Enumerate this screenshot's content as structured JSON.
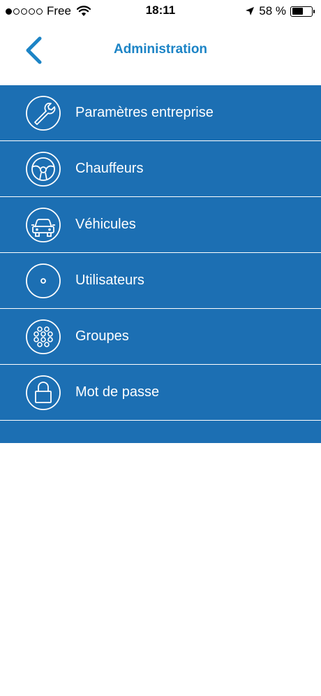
{
  "status_bar": {
    "carrier": "Free",
    "time": "18:11",
    "battery_percent_text": "58 %",
    "battery_level": 0.58
  },
  "nav": {
    "title": "Administration",
    "back_icon": "chevron-left-icon"
  },
  "colors": {
    "accent": "#1c84c6",
    "menu_background": "#1c6fb3",
    "menu_text": "#ffffff"
  },
  "menu": {
    "items": [
      {
        "label": "Paramètres entreprise",
        "icon": "wrench-icon"
      },
      {
        "label": "Chauffeurs",
        "icon": "steering-wheel-icon"
      },
      {
        "label": "Véhicules",
        "icon": "car-icon"
      },
      {
        "label": "Utilisateurs",
        "icon": "user-icon"
      },
      {
        "label": "Groupes",
        "icon": "group-icon"
      },
      {
        "label": "Mot de passe",
        "icon": "lock-icon"
      }
    ]
  }
}
